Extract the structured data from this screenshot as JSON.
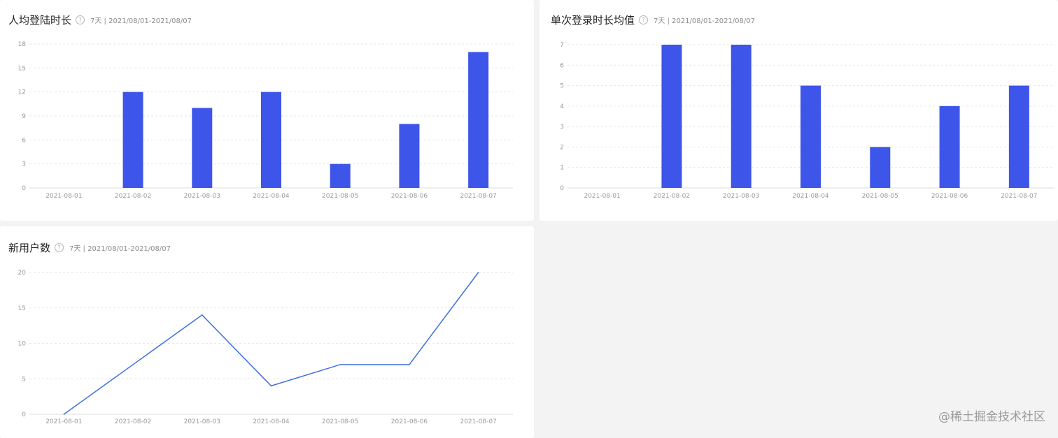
{
  "charts": [
    {
      "title": "人均登陆时长",
      "meta": "7天 | 2021/08/01-2021/08/07",
      "help_icon": "question-circle-icon"
    },
    {
      "title": "单次登录时长均值",
      "meta": "7天 | 2021/08/01-2021/08/07",
      "help_icon": "question-circle-icon"
    },
    {
      "title": "新用户数",
      "meta": "7天 | 2021/08/01-2021/08/07",
      "help_icon": "question-circle-icon"
    }
  ],
  "watermark": "@稀土掘金技术社区",
  "colors": {
    "bar": "#3d55e8",
    "line": "#3e6fe0"
  },
  "chart_data": [
    {
      "type": "bar",
      "title": "人均登陆时长",
      "categories": [
        "2021-08-01",
        "2021-08-02",
        "2021-08-03",
        "2021-08-04",
        "2021-08-05",
        "2021-08-06",
        "2021-08-07"
      ],
      "values": [
        0,
        12,
        10,
        12,
        3,
        8,
        17
      ],
      "ylim": [
        0,
        18
      ],
      "yticks": [
        0,
        3,
        6,
        9,
        12,
        15,
        18
      ],
      "grid": true
    },
    {
      "type": "bar",
      "title": "单次登录时长均值",
      "categories": [
        "2021-08-01",
        "2021-08-02",
        "2021-08-03",
        "2021-08-04",
        "2021-08-05",
        "2021-08-06",
        "2021-08-07"
      ],
      "values": [
        0,
        7,
        7,
        5,
        2,
        4,
        5
      ],
      "ylim": [
        0,
        7
      ],
      "yticks": [
        0,
        1,
        2,
        3,
        4,
        5,
        6,
        7
      ],
      "grid": true
    },
    {
      "type": "line",
      "title": "新用户数",
      "categories": [
        "2021-08-01",
        "2021-08-02",
        "2021-08-03",
        "2021-08-04",
        "2021-08-05",
        "2021-08-06",
        "2021-08-07"
      ],
      "values": [
        0,
        7,
        14,
        4,
        7,
        7,
        20
      ],
      "ylim": [
        0,
        20
      ],
      "yticks": [
        0,
        5,
        10,
        15,
        20
      ],
      "grid": true
    }
  ]
}
